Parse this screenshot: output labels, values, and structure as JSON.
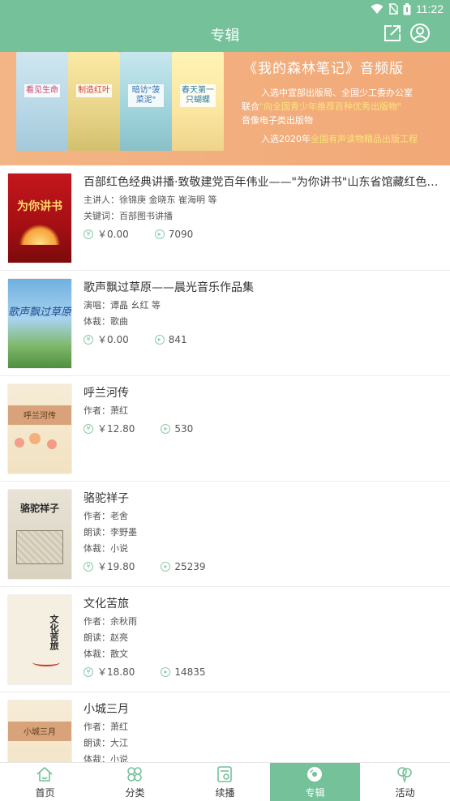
{
  "status_bar": {
    "time": "11:22"
  },
  "header": {
    "title": "专辑",
    "share_icon": "share-icon",
    "user_icon": "user-icon"
  },
  "banner": {
    "books": [
      "看见生命",
      "制造红叶",
      "暗访\"菠菜泥\"",
      "春天第一只蝴蝶"
    ],
    "title": "《我的森林笔记》音频版",
    "line1": "入选中宣部出版局、全国少工委办公室",
    "line2_prefix": "联合",
    "line2_highlight": "\"向全国青少年推荐百种优秀出版物\"",
    "line3": "音像电子类出版物",
    "line4_prefix": "入选2020年",
    "line4_highlight": "全国有声读物精品出版工程",
    "dots": 6,
    "active_dot": 0,
    "colors": {
      "bg": "#f2ad7c",
      "highlight": "#fce47a"
    }
  },
  "albums": [
    {
      "title": "百部红色经典讲播·致敬建党百年伟业——\"为你讲书\"山东省馆藏红色经典",
      "meta": [
        "主讲人：徐锦庚 金晓东 崔海明 等",
        "关键词：百部图书讲播"
      ],
      "cover_text": "为你讲书",
      "price": "￥0.00",
      "plays": "7090"
    },
    {
      "title": "歌声飘过草原——晨光音乐作品集",
      "meta": [
        "演唱：谭晶 幺红 等",
        "体裁：歌曲"
      ],
      "cover_text": "歌声飘过草原",
      "price": "￥0.00",
      "plays": "841"
    },
    {
      "title": "呼兰河传",
      "meta": [
        "作者：萧红"
      ],
      "cover_text": "呼兰河传",
      "price": "￥12.80",
      "plays": "530"
    },
    {
      "title": "骆驼祥子",
      "meta": [
        "作者：老舍",
        "朗读：李野墨",
        "体裁：小说"
      ],
      "cover_text": "骆驼祥子",
      "price": "￥19.80",
      "plays": "25239"
    },
    {
      "title": "文化苦旅",
      "meta": [
        "作者：余秋雨",
        "朗读：赵亮",
        "体裁：散文"
      ],
      "cover_text": "文化苦旅",
      "price": "￥18.80",
      "plays": "14835"
    },
    {
      "title": "小城三月",
      "meta": [
        "作者：萧红",
        "朗读：大江",
        "体裁：小说"
      ],
      "cover_text": "小城三月",
      "price": "",
      "plays": ""
    }
  ],
  "tabs": [
    {
      "label": "首页",
      "icon": "home-icon",
      "active": false
    },
    {
      "label": "分类",
      "icon": "category-icon",
      "active": false
    },
    {
      "label": "续播",
      "icon": "continue-play-icon",
      "active": false
    },
    {
      "label": "专辑",
      "icon": "album-disc-icon",
      "active": true
    },
    {
      "label": "活动",
      "icon": "activity-balloon-icon",
      "active": false
    }
  ],
  "colors": {
    "primary": "#74c19a",
    "stat_icon": "#8ccaa8",
    "divider": "#ededed"
  }
}
